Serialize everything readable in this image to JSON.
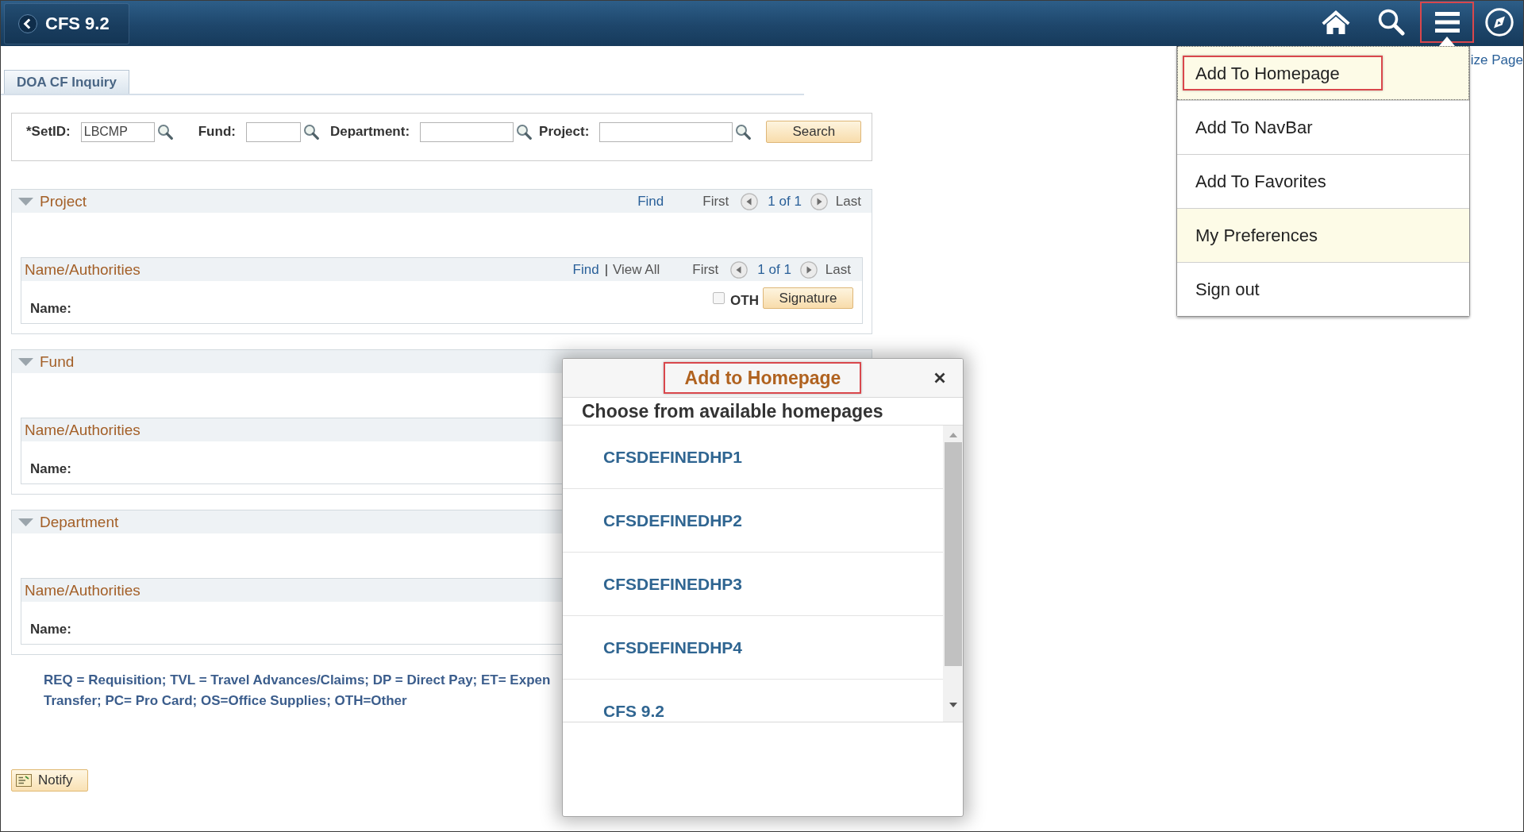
{
  "header": {
    "back_label": "CFS 9.2",
    "icons": [
      {
        "kind": "home",
        "marked": false
      },
      {
        "kind": "search",
        "marked": false
      },
      {
        "kind": "menu",
        "marked": true
      },
      {
        "kind": "compass",
        "marked": false
      }
    ]
  },
  "personalize_link": "ize Page",
  "tabs": [
    {
      "label": "DOA CF Inquiry",
      "selected": true
    }
  ],
  "search_bar": {
    "fields": [
      {
        "label": "*SetID:",
        "value": "LBCMP"
      },
      {
        "label": "Fund:"
      },
      {
        "label": "Department:"
      },
      {
        "label": "Project:"
      }
    ],
    "button": "Search"
  },
  "sections": [
    {
      "title": "Project",
      "expanded": true,
      "pager": {
        "find": "Find",
        "first": "First",
        "count": "1 of 1",
        "last": "Last"
      },
      "subsection": {
        "title": "Name/Authorities",
        "pager": {
          "find": "Find",
          "separator": "|",
          "view_all": "View All",
          "first": "First",
          "count": "1 of 1",
          "last": "Last"
        },
        "name_label": "Name:",
        "checkbox": {
          "label": "OTH",
          "checked": false
        },
        "button": "Signature"
      }
    },
    {
      "title": "Fund",
      "expanded": true,
      "subsection": {
        "title": "Name/Authorities",
        "name_label": "Name:"
      }
    },
    {
      "title": "Department",
      "expanded": true,
      "subsection": {
        "title": "Name/Authorities",
        "name_label": "Name:"
      }
    }
  ],
  "legend": [
    "REQ = Requisition; TVL = Travel Advances/Claims; DP = Direct Pay; ET= Expen",
    "Transfer; PC= Pro Card; OS=Office Supplies; OTH=Other"
  ],
  "notify_button": "Notify",
  "menu": {
    "items": [
      {
        "label": "Add To Homepage",
        "highlighted": true,
        "focused": true,
        "marked": true
      },
      {
        "label": "Add To NavBar",
        "highlighted": false,
        "focused": false,
        "marked": false
      },
      {
        "label": "Add To Favorites",
        "highlighted": false,
        "focused": false,
        "marked": false
      },
      {
        "label": "My Preferences",
        "highlighted": true,
        "focused": false,
        "marked": false
      },
      {
        "label": "Sign out",
        "highlighted": false,
        "focused": false,
        "marked": false
      }
    ]
  },
  "dialog": {
    "title": "Add to Homepage",
    "title_marked": true,
    "subtitle": "Choose from available homepages",
    "homepages": [
      "CFSDEFINEDHP1",
      "CFSDEFINEDHP2",
      "CFSDEFINEDHP3",
      "CFSDEFINEDHP4",
      "CFS 9.2"
    ]
  }
}
